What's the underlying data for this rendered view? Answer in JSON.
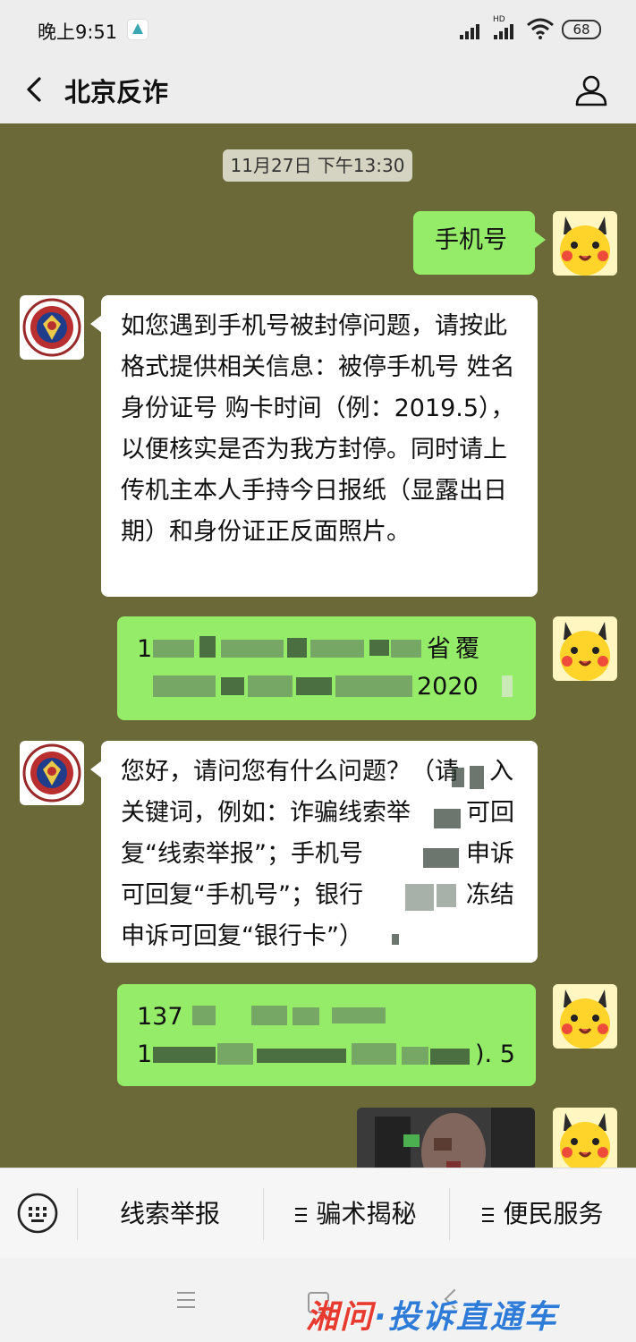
{
  "status_bar": {
    "time": "晚上9:51",
    "network_badge": "HD",
    "battery": "68"
  },
  "header": {
    "title": "北京反诈"
  },
  "chat": {
    "timestamp": "11月27日 下午13:30",
    "messages": [
      {
        "sender": "me",
        "text": "手机号"
      },
      {
        "sender": "official",
        "text": "如您遇到手机号被封停问题，请按此格式提供相关信息：被停手机号  姓名  身份证号  购卡时间（例：2019.5），以便核实是否为我方封停。同时请上传机主本人手持今日报纸（显露出日期）和身份证正反面照片。"
      },
      {
        "sender": "me",
        "text_visible_fragments": [
          "1",
          "省",
          "覆",
          "2020"
        ]
      },
      {
        "sender": "official",
        "text_lines": [
          "您好，请问您有什么问题？（请",
          "入",
          "关键词，例如：诈骗线索举",
          "可回",
          "复“线索举报”；手机号",
          "申诉",
          "可回复“手机号”；银行",
          "冻结",
          "申诉可回复“银行卡”）"
        ]
      },
      {
        "sender": "me",
        "text_visible_fragments": [
          "137",
          "1",
          "). 5"
        ]
      },
      {
        "sender": "me",
        "type": "image"
      }
    ]
  },
  "menu": {
    "items": [
      {
        "label": "线索举报",
        "has_submenu": false
      },
      {
        "label": "骗术揭秘",
        "has_submenu": true
      },
      {
        "label": "便民服务",
        "has_submenu": true
      }
    ]
  },
  "watermark": {
    "part1": "湘问",
    "dot": "·",
    "part2": "投诉直通车"
  },
  "colors": {
    "chat_background": "#6b6938",
    "sent_bubble": "#95ec69",
    "received_bubble": "#ffffff",
    "bar_background": "#ededed",
    "watermark_red": "#e63b2e",
    "watermark_blue": "#2f7bd8"
  }
}
